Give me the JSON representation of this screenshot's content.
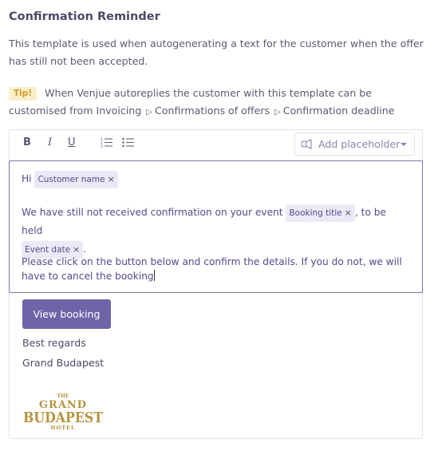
{
  "title": "Confirmation Reminder",
  "description": "This template is used when autogenerating a text for the customer when the offer has still not been accepted.",
  "tip": {
    "badge": "Tip!",
    "text": "When Venjue autoreplies the customer with this template can be customised from",
    "path": [
      "Invoicing",
      "Confirmations of offers",
      "Confirmation deadline"
    ]
  },
  "toolbar": {
    "bold": "B",
    "italic": "I",
    "underline": "U",
    "placeholder_label": "Add placeholder"
  },
  "body": {
    "greeting": "Hi",
    "chip_customer": "Customer name",
    "line2_pre": "We have still not received confirmation on your event",
    "chip_booking": "Booking title",
    "line2_post": ", to be held",
    "chip_date": "Event date",
    "line2_end": ".",
    "line3": "Please click on the button below and confirm the details. If you do not, we will have to cancel the booking",
    "chip_close": "×"
  },
  "button_label": "View booking",
  "signature": [
    "Best regards",
    "Grand Budapest"
  ],
  "logo": {
    "top": "THE",
    "line1": "GRAND",
    "line2": "BUDAPEST",
    "line3": "HOTEL"
  },
  "colors": {
    "accent": "#6f64a8",
    "chip_bg": "#ece9f7",
    "tip_bg": "#fbeecb",
    "tip_text": "#d29b2a",
    "logo": "#b5943f"
  }
}
